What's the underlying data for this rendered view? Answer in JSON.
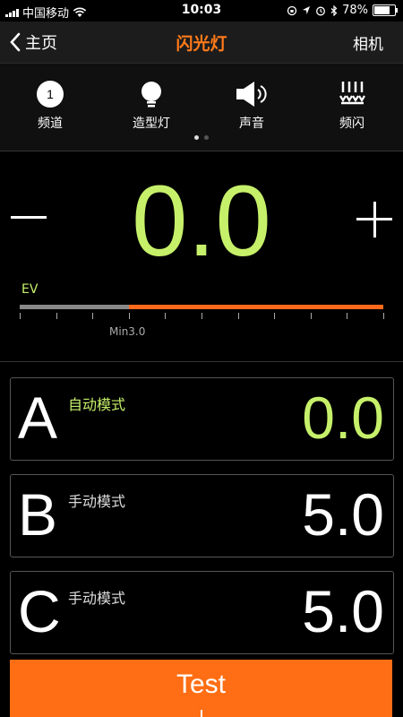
{
  "status_bar": {
    "carrier": "中国移动",
    "time": "10:03",
    "battery_percent": "78%",
    "battery_level": 0.78,
    "icons": [
      "signal-icon",
      "wifi-icon",
      "rotation-lock-icon",
      "location-icon",
      "alarm-icon",
      "bluetooth-icon",
      "battery-icon"
    ]
  },
  "nav": {
    "back_label": "主页",
    "title": "闪光灯",
    "right_label": "相机"
  },
  "features": [
    {
      "label": "频道",
      "icon": "channel-icon",
      "badge": "1"
    },
    {
      "label": "造型灯",
      "icon": "modeling-lamp-icon"
    },
    {
      "label": "声音",
      "icon": "speaker-icon"
    },
    {
      "label": "频闪",
      "icon": "multi-flash-icon"
    }
  ],
  "page_indicator": {
    "count": 2,
    "active": 0
  },
  "ev": {
    "value": "0.0",
    "label": "EV",
    "min_label": "Min3.0",
    "slider_position": 0.3,
    "tick_count": 11
  },
  "groups": [
    {
      "letter": "A",
      "mode": "自动模式",
      "value": "0.0",
      "auto": true
    },
    {
      "letter": "B",
      "mode": "手动模式",
      "value": "5.0",
      "auto": false
    },
    {
      "letter": "C",
      "mode": "手动模式",
      "value": "5.0",
      "auto": false
    }
  ],
  "test_label": "Test",
  "colors": {
    "accent_orange": "#ff6e14",
    "value_green": "#c6f06a",
    "title_orange": "#ff7a1a"
  }
}
